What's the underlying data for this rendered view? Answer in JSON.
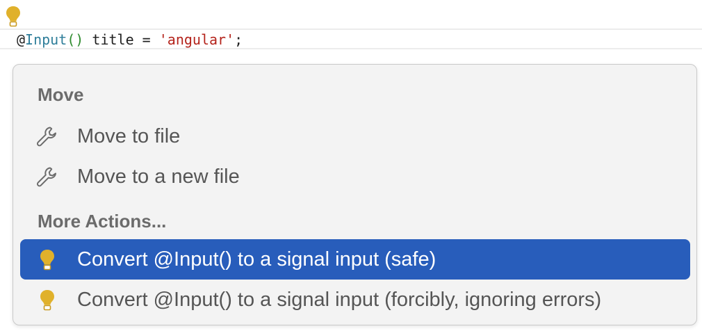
{
  "editor": {
    "code": {
      "at": "@",
      "decorator": "Input",
      "parens": "()",
      "middle": " title = ",
      "string": "'angular'",
      "end": ";"
    }
  },
  "popup": {
    "groups": [
      {
        "header": "Move",
        "items": [
          {
            "label": "Move to file",
            "icon": "wrench-icon"
          },
          {
            "label": "Move to a new file",
            "icon": "wrench-icon"
          }
        ]
      },
      {
        "header": "More Actions...",
        "items": [
          {
            "label": "Convert @Input() to a signal input (safe)",
            "icon": "lightbulb-icon",
            "selected": true
          },
          {
            "label": "Convert @Input() to a signal input (forcibly, ignoring errors)",
            "icon": "lightbulb-icon"
          }
        ]
      }
    ]
  },
  "colors": {
    "selection": "#285dbb",
    "bulb": "#e0b12b",
    "header_text": "#6b6b6b",
    "item_text": "#555555"
  }
}
